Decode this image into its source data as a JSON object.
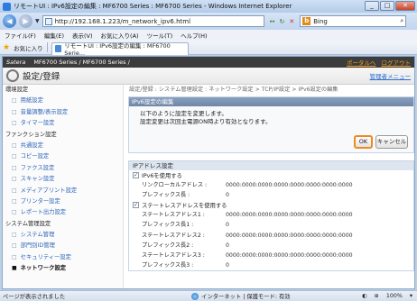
{
  "window": {
    "title": "リモートUI : IPv6設定の編集 : MF6700 Series : MF6700 Series - Windows Internet Explorer",
    "minimize": "_",
    "maximize": "□",
    "close": "✕"
  },
  "nav": {
    "back": "◀",
    "forward": "▶",
    "history": "▼",
    "url": "http://192.168.1.223/m_network_ipv6.html",
    "refresh": "↻",
    "refresh_arrows": "↔",
    "stop": "✕",
    "search_placeholder": "Bing",
    "search_icon": "b",
    "search_glyph": "⌕"
  },
  "menu": [
    "ファイル(F)",
    "編集(E)",
    "表示(V)",
    "お気に入り(A)",
    "ツール(T)",
    "ヘルプ(H)"
  ],
  "favorites": {
    "label": "お気に入り",
    "tab_label": "リモートUI : IPv6設定の編集 : MF6700 Serie..."
  },
  "header": {
    "brand": "Satera",
    "model": "MF6700 Series / MF6700 Series /",
    "portal_link": "ポータルへ",
    "logout": "ログアウト",
    "page_title": "設定/登録",
    "admin_menu": "管理者メニュー"
  },
  "sidebar": {
    "sections": [
      {
        "title": "環境設定",
        "items": [
          "用紙設定",
          "音量調整/表示設定",
          "タイマー設定"
        ]
      },
      {
        "title": "ファンクション設定",
        "items": [
          "共通設定",
          "コピー設定",
          "ファクス設定",
          "スキャン設定",
          "メディアプリント設定",
          "プリンター設定",
          "レポート出力設定"
        ]
      },
      {
        "title": "システム管理設定",
        "items": [
          "システム管理",
          "部門別ID管理",
          "セキュリティー設定",
          "ネットワーク設定"
        ]
      }
    ]
  },
  "main": {
    "breadcrumb": "設定/登録 : システム管理設定 : ネットワーク設定 > TCP/IP設定 > IPv6設定の編集",
    "edit_box": {
      "title": "IPv6設定の編集",
      "message1": "以下のように設定を変更します。",
      "message2": "設定変更は次回主電源ON時より有効となります。",
      "ok": "OK",
      "cancel": "キャンセル"
    },
    "ip_section": {
      "title": "IPアドレス設定",
      "use_ipv6": "IPv6を使用する",
      "use_stateless": "ステートレスアドレスを使用する",
      "check_mark": "✓",
      "rows_a": [
        {
          "label": "リンクローカルアドレス :",
          "value": "0000:0000:0000:0000:0000:0000:0000:0000"
        },
        {
          "label": "プレフィックス長 :",
          "value": "0"
        }
      ],
      "rows_b": [
        {
          "label": "ステートレスアドレス1 :",
          "value": "0000:0000:0000:0000:0000:0000:0000:0000"
        },
        {
          "label": "プレフィックス長1 :",
          "value": "0"
        },
        {
          "label": "ステートレスアドレス2 :",
          "value": "0000:0000:0000:0000:0000:0000:0000:0000"
        },
        {
          "label": "プレフィックス長2 :",
          "value": "0"
        },
        {
          "label": "ステートレスアドレス3 :",
          "value": "0000:0000:0000:0000:0000:0000:0000:0000"
        },
        {
          "label": "プレフィックス長3 :",
          "value": "0"
        }
      ]
    }
  },
  "status": {
    "left": "ページが表示されました",
    "zone": "インターネット | 保護モード: 有効",
    "zone_icon": "⊕",
    "security": "◐",
    "zoom": "100%",
    "zoom_arrow": "▾"
  }
}
